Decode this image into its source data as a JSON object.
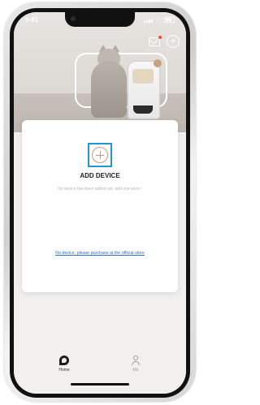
{
  "status_bar": {
    "time": "9:41"
  },
  "header": {
    "icons": [
      "mail-icon",
      "add-icon"
    ],
    "notification_color": "#e6533c"
  },
  "card": {
    "add_title": "ADD DEVICE",
    "subtitle": "No device has been added yet, add one soon~",
    "store_link": "No device, please purchase at the official store",
    "accent_color": "#1f98d6",
    "plus_color": "#c79a77",
    "link_color": "#2f6ec0"
  },
  "tabbar": {
    "home_label": "Home",
    "me_label": "Me"
  }
}
